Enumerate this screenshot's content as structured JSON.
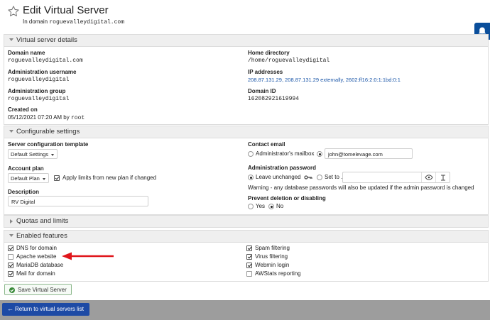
{
  "header": {
    "title": "Edit Virtual Server",
    "subtitle_prefix": "In domain",
    "subtitle_domain": "roguevalleydigital.com"
  },
  "details": {
    "section_title": "Virtual server details",
    "domain_name_label": "Domain name",
    "domain_name": "roguevalleydigital.com",
    "admin_username_label": "Administration username",
    "admin_username": "roguevalleydigital",
    "admin_group_label": "Administration group",
    "admin_group": "roguevalleydigital",
    "created_on_label": "Created on",
    "created_on_date": "05/12/2021 07:20 AM by",
    "created_on_user": "root",
    "home_dir_label": "Home directory",
    "home_dir": "/home/roguevalleydigital",
    "ip_label": "IP addresses",
    "ip_value": "208.87.131.29, 208.87.131.29 externally, 2602:ff16:2:0:1:1bd:0:1",
    "domain_id_label": "Domain ID",
    "domain_id": "162082921619994"
  },
  "config": {
    "section_title": "Configurable settings",
    "template_label": "Server configuration template",
    "template_value": "Default Settings",
    "plan_label": "Account plan",
    "plan_value": "Default Plan",
    "apply_limits_label": "Apply limits from new plan if changed",
    "description_label": "Description",
    "description_value": "RV Digital",
    "contact_label": "Contact email",
    "contact_option1": "Administrator's mailbox",
    "contact_email": "john@tomelevage.com",
    "password_label": "Administration password",
    "password_option1": "Leave unchanged",
    "password_option2": "Set to ..",
    "password_warning": "Warning - any database passwords will also be updated if the admin password is changed",
    "prevent_label": "Prevent deletion or disabling",
    "prevent_yes": "Yes",
    "prevent_no": "No"
  },
  "quotas": {
    "section_title": "Quotas and limits"
  },
  "features": {
    "section_title": "Enabled features",
    "left": [
      {
        "label": "DNS for domain",
        "checked": true
      },
      {
        "label": "Apache website",
        "checked": false
      },
      {
        "label": "MariaDB database",
        "checked": true
      },
      {
        "label": "Mail for domain",
        "checked": true
      }
    ],
    "right": [
      {
        "label": "Spam filtering",
        "checked": true
      },
      {
        "label": "Virus filtering",
        "checked": true
      },
      {
        "label": "Webmin login",
        "checked": true
      },
      {
        "label": "AWStats reporting",
        "checked": false
      }
    ]
  },
  "actions": {
    "save_label": "Save Virtual Server",
    "return_label": "Return to virtual servers list"
  },
  "colors": {
    "accent_blue": "#1d4aa5",
    "annotation_red": "#e0161b",
    "save_green": "#3a8a3a"
  },
  "icons": [
    "star-icon",
    "bell-icon",
    "check-circle-icon",
    "arrow-left-icon",
    "eye-icon",
    "key-icon",
    "generate-icon"
  ]
}
